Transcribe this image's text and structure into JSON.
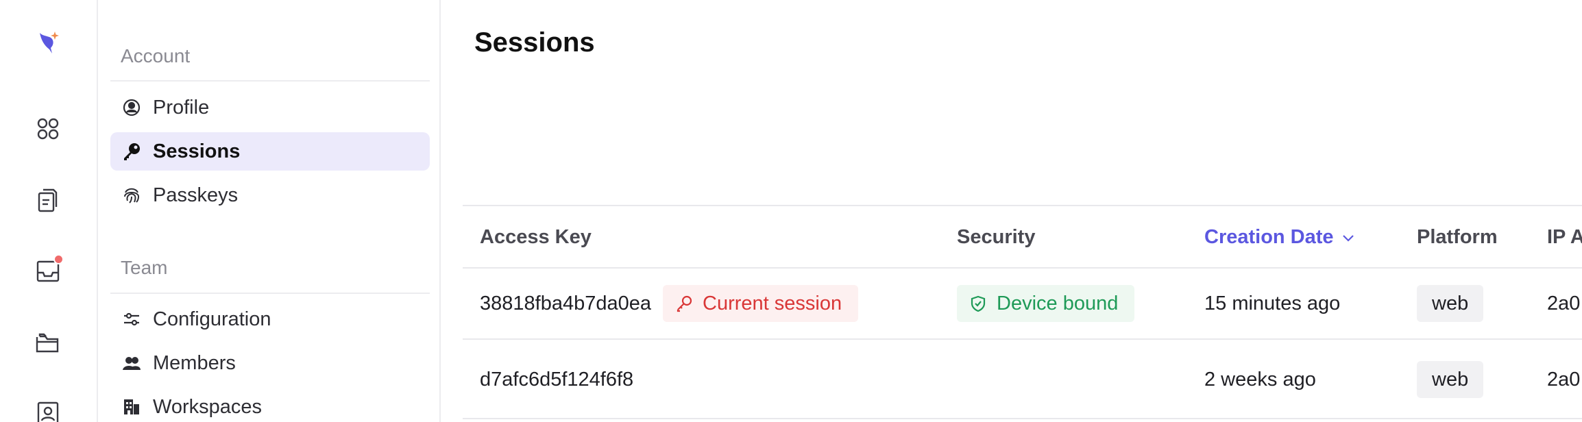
{
  "colors": {
    "accent": "#5b57e0",
    "logo_orange": "#f08a4b",
    "notification_dot": "#f06b6b",
    "current_session_red": "#d93636",
    "device_bound_green": "#1e9a57",
    "active_nav_bg": "#eceafb"
  },
  "rail": {
    "icons": [
      "logo-icon",
      "apps-icon",
      "documents-icon",
      "inbox-icon",
      "folder-icon",
      "contacts-icon"
    ]
  },
  "nav": {
    "account_heading": "Account",
    "team_heading": "Team",
    "items": [
      {
        "label": "Profile",
        "icon": "user-circle-icon"
      },
      {
        "label": "Sessions",
        "icon": "key-icon",
        "active": true
      },
      {
        "label": "Passkeys",
        "icon": "fingerprint-icon"
      },
      {
        "label": "Configuration",
        "icon": "sliders-icon"
      },
      {
        "label": "Members",
        "icon": "users-icon"
      },
      {
        "label": "Workspaces",
        "icon": "building-icon"
      }
    ]
  },
  "main": {
    "title": "Sessions"
  },
  "table": {
    "columns": [
      "Access Key",
      "Security",
      "Creation Date",
      "Platform",
      "IP A"
    ],
    "sorted_column": "Creation Date",
    "rows": [
      {
        "access_key": "38818fba4b7da0ea",
        "current_label": "Current session",
        "security": "Device bound",
        "created": "15 minutes ago",
        "platform": "web",
        "ip": "2a0"
      },
      {
        "access_key": "d7afc6d5f124f6f8",
        "created": "2 weeks ago",
        "platform": "web",
        "ip": "2a0"
      }
    ]
  }
}
